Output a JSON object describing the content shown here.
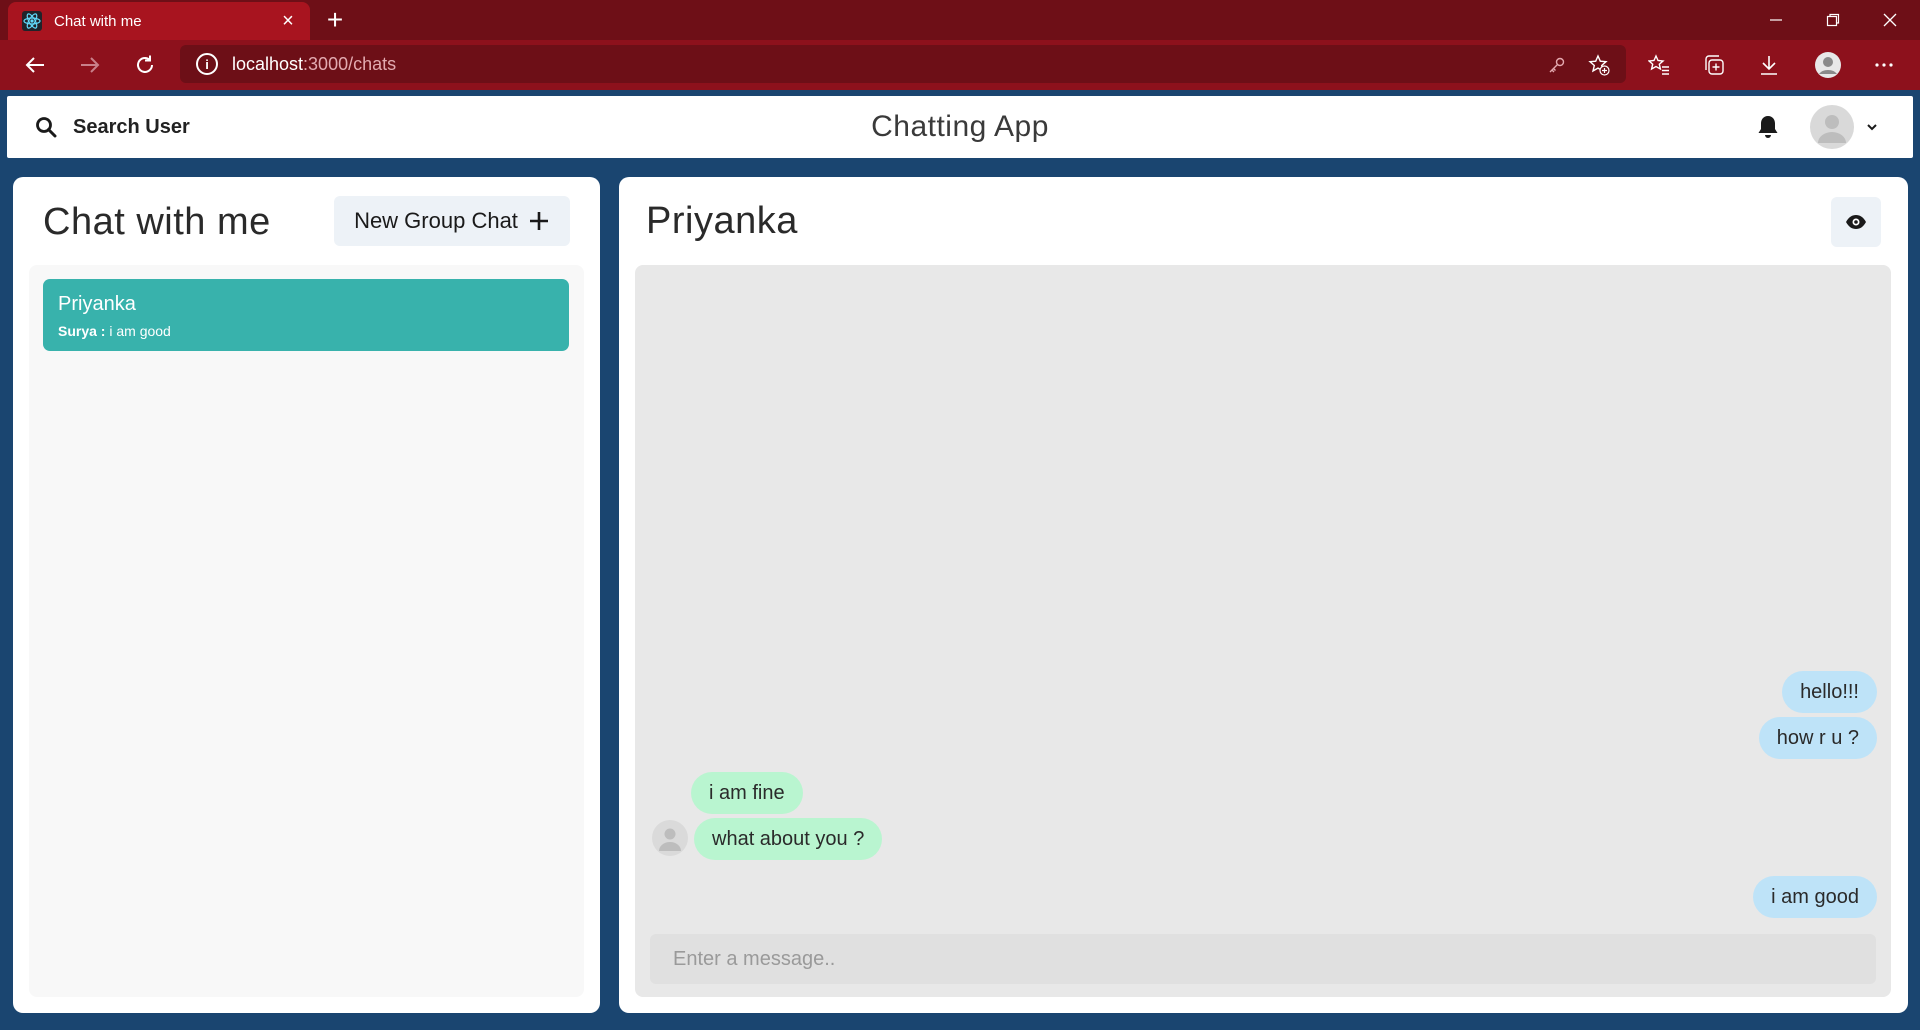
{
  "browser": {
    "tab_title": "Chat with me",
    "tab_close": "×",
    "new_tab": "+",
    "url_host": "localhost",
    "url_path": ":3000/chats",
    "info_glyph": "i"
  },
  "header": {
    "search_label": "Search User",
    "app_title": "Chatting App"
  },
  "sidebar": {
    "title": "Chat with me",
    "new_group_label": "New Group Chat",
    "chats": [
      {
        "name": "Priyanka",
        "last_sender": "Surya :",
        "last_message": " i am good"
      }
    ]
  },
  "chat": {
    "title": "Priyanka",
    "messages": [
      {
        "text": "hello!!!",
        "direction": "sent"
      },
      {
        "text": "how r u ?",
        "direction": "sent"
      },
      {
        "text": "i am fine",
        "direction": "received"
      },
      {
        "text": "what about you ?",
        "direction": "received"
      },
      {
        "text": "i am good",
        "direction": "sent"
      }
    ],
    "input_placeholder": "Enter a message.."
  },
  "colors": {
    "chrome_dark": "#6e0f17",
    "chrome_tab": "#a8141f",
    "chrome_bar": "#8d111c",
    "page_background": "#1a4570",
    "chat_selected": "#38b2ac",
    "sent_bubble": "#bee3f8",
    "received_bubble": "#b9f5d0"
  }
}
